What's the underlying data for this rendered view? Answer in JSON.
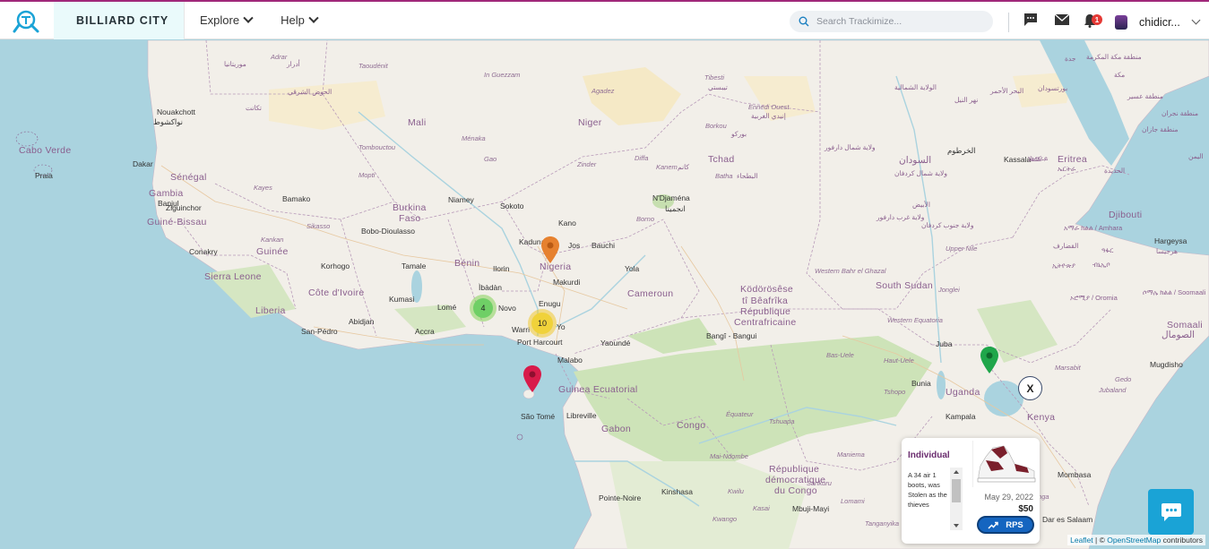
{
  "header": {
    "brand": "BILLIARD CITY",
    "nav": [
      {
        "label": "Explore"
      },
      {
        "label": "Help"
      }
    ],
    "search_placeholder": "Search Trackimize...",
    "notification_count": "1",
    "username": "chidicr..."
  },
  "map": {
    "labels": {
      "countries": [
        {
          "text": "Cabo Verde"
        },
        {
          "text": "Sénégal"
        },
        {
          "text": "Gambia"
        },
        {
          "text": "Guiné-Bissau"
        },
        {
          "text": "Guinée"
        },
        {
          "text": "Sierra Leone"
        },
        {
          "text": "Liberia"
        },
        {
          "text": "Côte d'Ivoire"
        },
        {
          "text": "Mali"
        },
        {
          "text": "Burkina"
        },
        {
          "text": "Faso"
        },
        {
          "text": "Niger"
        },
        {
          "text": "Nigeria"
        },
        {
          "text": "Bénin"
        },
        {
          "text": "Tchad"
        },
        {
          "text": "Cameroun"
        },
        {
          "text": "Ködörösêse"
        },
        {
          "text": "tî Bêafrîka"
        },
        {
          "text": "République"
        },
        {
          "text": "Centrafricaine"
        },
        {
          "text": "Guinea Ecuatorial"
        },
        {
          "text": "Gabon"
        },
        {
          "text": "Congo"
        },
        {
          "text": "République"
        },
        {
          "text": "démocratique"
        },
        {
          "text": "du Congo"
        },
        {
          "text": "Uganda"
        },
        {
          "text": "Kenya"
        },
        {
          "text": "Djibouti"
        },
        {
          "text": "Eritrea"
        },
        {
          "text": "South Sudan"
        },
        {
          "text": "السودان"
        },
        {
          "text": "Somaali"
        },
        {
          "text": "الصومال"
        }
      ],
      "cities": [
        {
          "text": "Praia"
        },
        {
          "text": "Dakar"
        },
        {
          "text": "Banjul"
        },
        {
          "text": "Ziguinchor"
        },
        {
          "text": "Bamako"
        },
        {
          "text": "Bobo-Dioulasso"
        },
        {
          "text": "Conakry"
        },
        {
          "text": "Korhogo"
        },
        {
          "text": "Tamale"
        },
        {
          "text": "Kumasi"
        },
        {
          "text": "Abidjan"
        },
        {
          "text": "San-Pédro"
        },
        {
          "text": "Accra"
        },
        {
          "text": "Lomé"
        },
        {
          "text": "Niamey"
        },
        {
          "text": "Sokoto"
        },
        {
          "text": "Kano"
        },
        {
          "text": "Kaduna"
        },
        {
          "text": "Jos"
        },
        {
          "text": "Bauchi"
        },
        {
          "text": "Ilorin"
        },
        {
          "text": "Ìbàdàn"
        },
        {
          "text": "Makurdi"
        },
        {
          "text": "Enugu"
        },
        {
          "text": "Yola"
        },
        {
          "text": "Port Harcourt"
        },
        {
          "text": "Malabo"
        },
        {
          "text": "Yaoundé"
        },
        {
          "text": "São Tomé"
        },
        {
          "text": "Libreville"
        },
        {
          "text": "N'Djaména"
        },
        {
          "text": "انجمينا"
        },
        {
          "text": "Bangî - Bangui"
        },
        {
          "text": "Juba"
        },
        {
          "text": "Bunia"
        },
        {
          "text": "Kampala"
        },
        {
          "text": "Kinshasa"
        },
        {
          "text": "Pointe-Noire"
        },
        {
          "text": "Mbuji-Mayi"
        },
        {
          "text": "Mombasa"
        },
        {
          "text": "Dar es Salaam"
        },
        {
          "text": "Mugdisho"
        },
        {
          "text": "Hargeysa"
        },
        {
          "text": "Kassala"
        },
        {
          "text": "Nouakchott"
        },
        {
          "text": "نواكشوط"
        },
        {
          "text": "الخرطوم"
        },
        {
          "text": "Warri"
        },
        {
          "text": "Novo"
        },
        {
          "text": "Yo"
        }
      ],
      "regions": [
        {
          "text": "Taoudénit"
        },
        {
          "text": "In Guezzam"
        },
        {
          "text": "Agadez"
        },
        {
          "text": "Tibesti"
        },
        {
          "text": "Ennedi Ouest"
        },
        {
          "text": "Borkou"
        },
        {
          "text": "Ménaka"
        },
        {
          "text": "Tombouctou"
        },
        {
          "text": "Gao"
        },
        {
          "text": "Zinder"
        },
        {
          "text": "Diffa"
        },
        {
          "text": "Kanem"
        },
        {
          "text": "Batha"
        },
        {
          "text": "Mopti"
        },
        {
          "text": "Kayes"
        },
        {
          "text": "Sikasso"
        },
        {
          "text": "Kankan"
        },
        {
          "text": "Borno"
        },
        {
          "text": "Western Bahr el Ghazal"
        },
        {
          "text": "Jonglei"
        },
        {
          "text": "Western Equatoria"
        },
        {
          "text": "Haut-Uele"
        },
        {
          "text": "Bas-Uele"
        },
        {
          "text": "Tshopo"
        },
        {
          "text": "Équateur"
        },
        {
          "text": "Tshuapa"
        },
        {
          "text": "Maniema"
        },
        {
          "text": "Sankuru"
        },
        {
          "text": "Kasai"
        },
        {
          "text": "Tanganyika"
        },
        {
          "text": "Kwango"
        },
        {
          "text": "Kwilu"
        },
        {
          "text": "Mai-Ndombe"
        },
        {
          "text": "Upper Nile"
        },
        {
          "text": "Marsabit"
        },
        {
          "text": "Jubaland"
        },
        {
          "text": "Tanga"
        },
        {
          "text": "Adrar"
        },
        {
          "text": "Gedo"
        },
        {
          "text": "Lomami"
        }
      ],
      "arabic": [
        {
          "text": "موريتانيا"
        },
        {
          "text": "أدرار"
        },
        {
          "text": "الحوض الشرقي"
        },
        {
          "text": "تكانت"
        },
        {
          "text": "تيبستي"
        },
        {
          "text": "إنيدي الغربية"
        },
        {
          "text": "بوركو"
        },
        {
          "text": "الولاية الشمالية"
        },
        {
          "text": "البحر الأحمر"
        },
        {
          "text": "نهر النيل"
        },
        {
          "text": "بورتسودان"
        },
        {
          "text": "ولاية شمال دارفور"
        },
        {
          "text": "كانم"
        },
        {
          "text": "البطحاء"
        },
        {
          "text": "ولاية شمال كردفان"
        },
        {
          "text": "الأبيض"
        },
        {
          "text": "ولاية غرب دارفور"
        },
        {
          "text": "ولاية جنوب كردفان"
        },
        {
          "text": "كسلا"
        },
        {
          "text": "القضارف"
        },
        {
          "text": "منطقة مكة المكرمة"
        },
        {
          "text": "منطقة عسير"
        },
        {
          "text": "منطقة نجران"
        },
        {
          "text": "منطقة جازان"
        },
        {
          "text": "الحديدة"
        },
        {
          "text": "اليمن"
        },
        {
          "text": "هرجيسا"
        },
        {
          "text": "ኢትዮጵያ"
        },
        {
          "text": "ኤርትራ"
        },
        {
          "text": "ትግራይ"
        },
        {
          "text": "አማራ ክልል / Amhara"
        },
        {
          "text": "ኦሮሚያ / Oromia"
        },
        {
          "text": "ሶማሌ ክልል / Soomaali"
        },
        {
          "text": "ዓፋር"
        },
        {
          "text": "ብኒኢቦ"
        },
        {
          "text": "جدة"
        },
        {
          "text": "مكة"
        }
      ]
    },
    "clusters": [
      {
        "count": "4",
        "color": "#6fcf66",
        "ring": "rgba(110,204,57,0.45)"
      },
      {
        "count": "10",
        "color": "#f0d23a",
        "ring": "rgba(240,194,12,0.45)"
      }
    ],
    "close_label": "X",
    "markers": [
      {
        "color": "#e6812f",
        "name": "orange-map-pin-icon"
      },
      {
        "color": "#d81b4a",
        "name": "red-map-pin-icon"
      },
      {
        "color": "#1fa64a",
        "name": "green-map-pin-icon"
      }
    ],
    "attribution": {
      "leaflet": "Leaflet",
      "sep": " | © ",
      "osm": "OpenStreetMap",
      "suffix": " contributors"
    }
  },
  "popup": {
    "title": "Individual",
    "description": "A 34 air 1 boots, was Stolen as the thieves",
    "date": "May 29, 2022",
    "price": "$50",
    "button_label": "RPS",
    "colors": {
      "title": "#6a2c6e",
      "button": "#1565c0"
    }
  },
  "chat": {
    "icon": "chat-bubble-icon"
  }
}
